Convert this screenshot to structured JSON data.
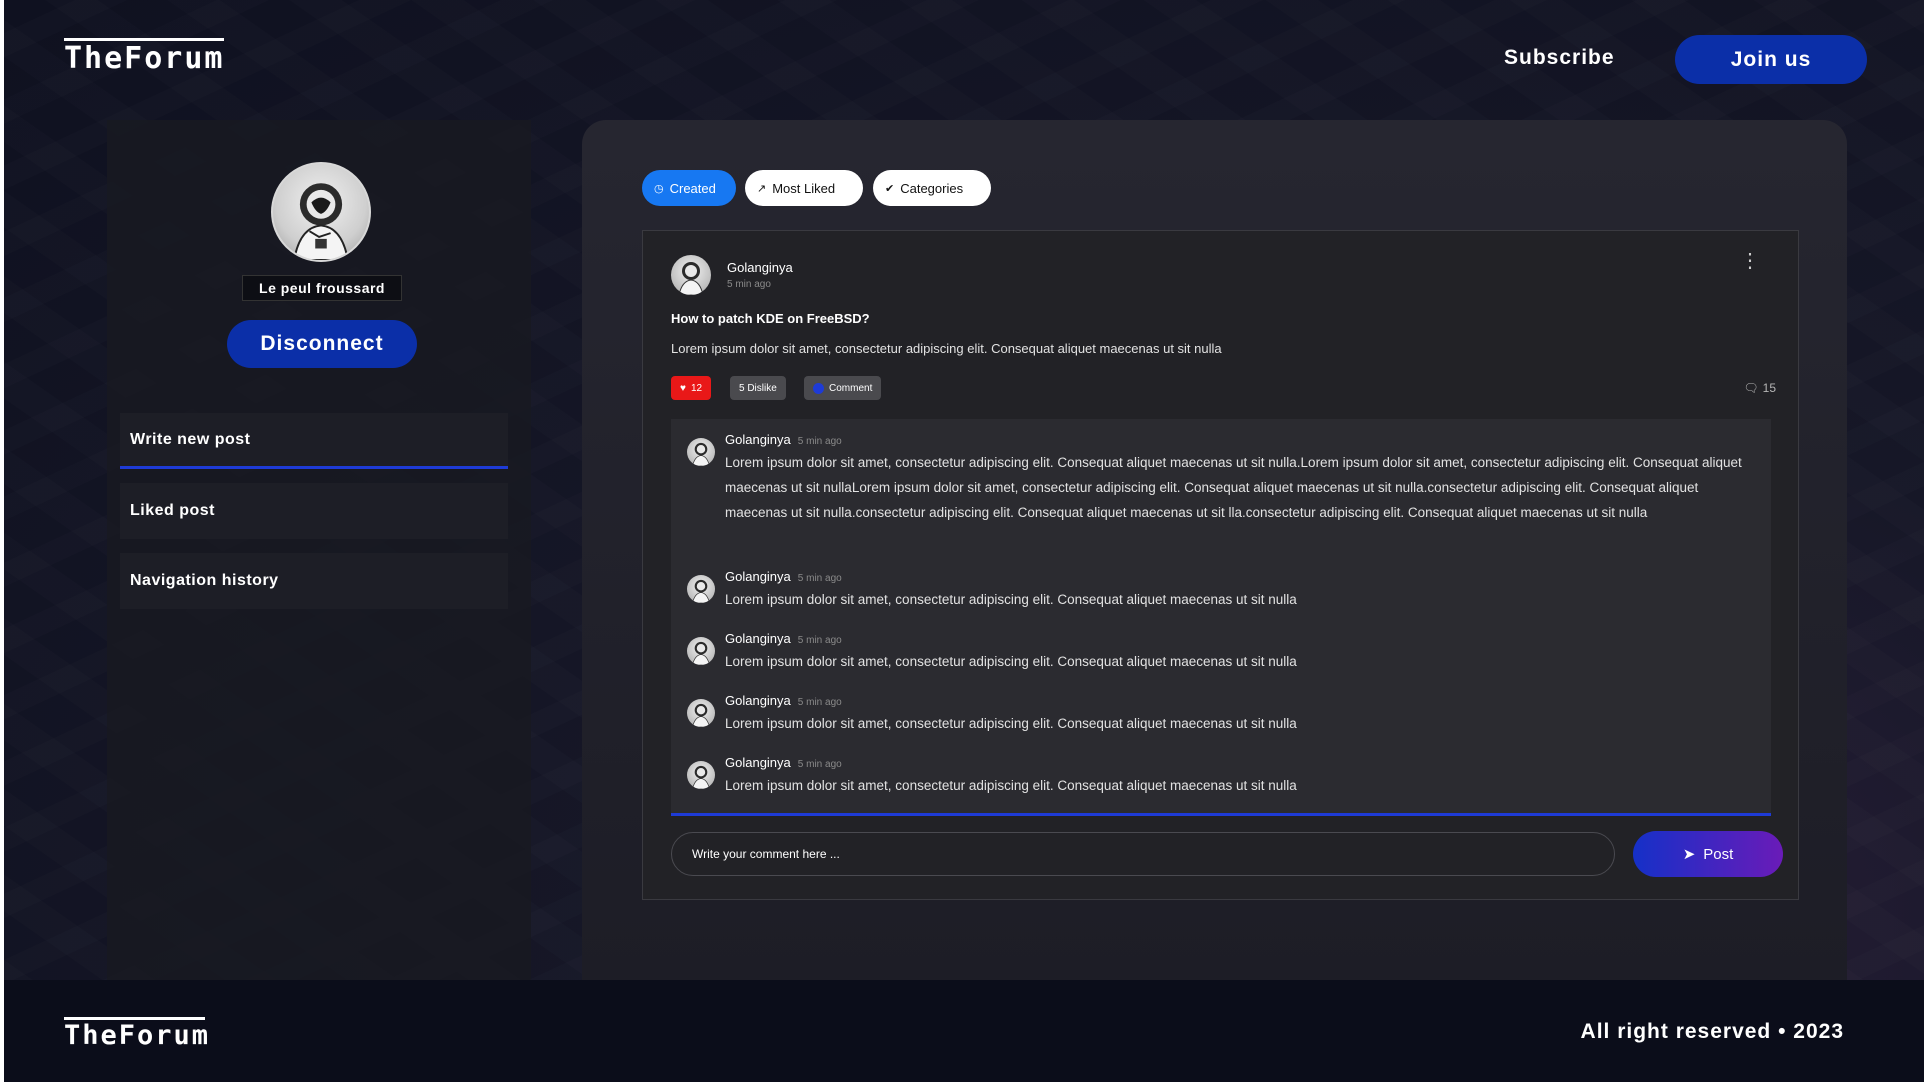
{
  "header": {
    "logo": "TheForum",
    "subscribe_label": "Subscribe",
    "join_label": "Join us"
  },
  "sidebar": {
    "username": "Le peul froussard",
    "disconnect_label": "Disconnect",
    "items": [
      {
        "label": "Write new post",
        "active": true
      },
      {
        "label": "Liked post",
        "active": false
      },
      {
        "label": "Navigation history",
        "active": false
      }
    ]
  },
  "tabs": [
    {
      "label": "Created",
      "icon": "clock-icon",
      "active": true
    },
    {
      "label": "Most Liked",
      "icon": "arrow-up-right-icon",
      "active": false
    },
    {
      "label": "Categories",
      "icon": "check-circle-icon",
      "active": false
    }
  ],
  "post": {
    "author": "Golanginya",
    "time": "5 min ago",
    "title": "How to patch KDE on FreeBSD?",
    "body": "Lorem ipsum dolor sit amet, consectetur adipiscing elit. Consequat aliquet maecenas ut sit nulla",
    "likes": "12",
    "dislike_label": "5 Dislike",
    "comment_label": "Comment",
    "comment_count": "15"
  },
  "comments": [
    {
      "author": "Golanginya",
      "time": "5 min ago",
      "text": "Lorem ipsum dolor sit amet, consectetur adipiscing elit. Consequat aliquet maecenas ut sit nulla.Lorem ipsum dolor sit amet, consectetur adipiscing elit. Consequat aliquet maecenas ut sit nullaLorem ipsum dolor sit amet, consectetur adipiscing elit. Consequat aliquet maecenas ut sit nulla.consectetur adipiscing elit. Consequat aliquet maecenas ut sit nulla.consectetur adipiscing elit. Consequat aliquet maecenas ut sit lla.consectetur adipiscing elit. Consequat aliquet maecenas ut sit nulla"
    },
    {
      "author": "Golanginya",
      "time": "5 min ago",
      "text": "Lorem ipsum dolor sit amet, consectetur adipiscing elit. Consequat aliquet maecenas ut sit nulla"
    },
    {
      "author": "Golanginya",
      "time": "5 min ago",
      "text": "Lorem ipsum dolor sit amet, consectetur adipiscing elit. Consequat aliquet maecenas ut sit nulla"
    },
    {
      "author": "Golanginya",
      "time": "5 min ago",
      "text": "Lorem ipsum dolor sit amet, consectetur adipiscing elit. Consequat aliquet maecenas ut sit nulla"
    },
    {
      "author": "Golanginya",
      "time": "5 min ago",
      "text": "Lorem ipsum dolor sit amet, consectetur adipiscing elit. Consequat aliquet maecenas ut sit nulla"
    }
  ],
  "composer": {
    "placeholder": "Write your comment  here ...",
    "post_label": "Post"
  },
  "footer": {
    "logo": "TheForum",
    "copyright": "All right reserved • 2023"
  },
  "colors": {
    "accent": "#0b2fa8",
    "active_tab": "#1778f2",
    "like": "#e91818"
  }
}
